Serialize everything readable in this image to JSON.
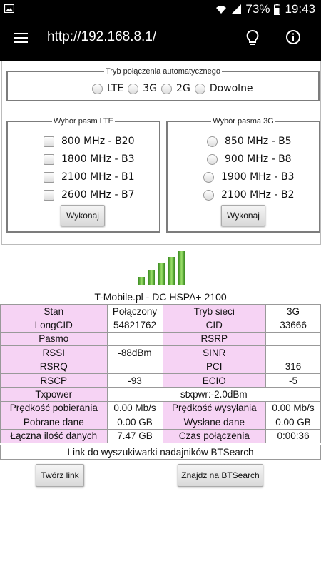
{
  "status_bar": {
    "battery": "73%",
    "time": "19:43"
  },
  "app_bar": {
    "url": "http://192.168.8.1/"
  },
  "mode": {
    "legend": "Tryb połączenia automatycznego",
    "options": [
      "LTE",
      "3G",
      "2G",
      "Dowolne"
    ]
  },
  "lte_bands": {
    "legend": "Wybór pasm LTE",
    "items": [
      "800 MHz - B20",
      "1800 MHz - B3",
      "2100 MHz - B1",
      "2600 MHz - B7"
    ],
    "button": "Wykonaj"
  },
  "bands_3g": {
    "legend": "Wybór pasma 3G",
    "items": [
      "850 MHz - B5",
      "900 MHz - B8",
      "1900 MHz - B3",
      "2100 MHz - B2"
    ],
    "button": "Wykonaj"
  },
  "signal": {
    "level": 5,
    "max": 5,
    "color": "#4aa82e"
  },
  "network_name": "T-Mobile.pl - DC HSPA+ 2100",
  "table": {
    "rows": [
      [
        "Stan",
        "Połączony",
        "Tryb sieci",
        "3G"
      ],
      [
        "LongCID",
        "54821762",
        "CID",
        "33666"
      ],
      [
        "Pasmo",
        "",
        "RSRP",
        ""
      ],
      [
        "RSSI",
        "-88dBm",
        "SINR",
        ""
      ],
      [
        "RSRQ",
        "",
        "PCI",
        "316"
      ],
      [
        "RSCP",
        "-93",
        "ECIO",
        "-5"
      ],
      [
        "Txpower",
        "stxpwr:-2.0dBm"
      ],
      [
        "Prędkość pobierania",
        "0.00 Mb/s",
        "Prędkość wysyłania",
        "0.00 Mb/s"
      ],
      [
        "Pobrane dane",
        "0.00 GB",
        "Wysłane dane",
        "0.00 GB"
      ],
      [
        "Łączna ilość danych",
        "7.47 GB",
        "Czas połączenia",
        "0:00:36"
      ]
    ]
  },
  "bts_link_text": "Link do wyszukiwarki nadajników BTSearch",
  "buttons": {
    "create_link": "Twórz link",
    "find_bts": "Znajdz na BTSearch"
  },
  "colors": {
    "key_cell": "#f6d3f4",
    "app_bar": "#000000"
  }
}
